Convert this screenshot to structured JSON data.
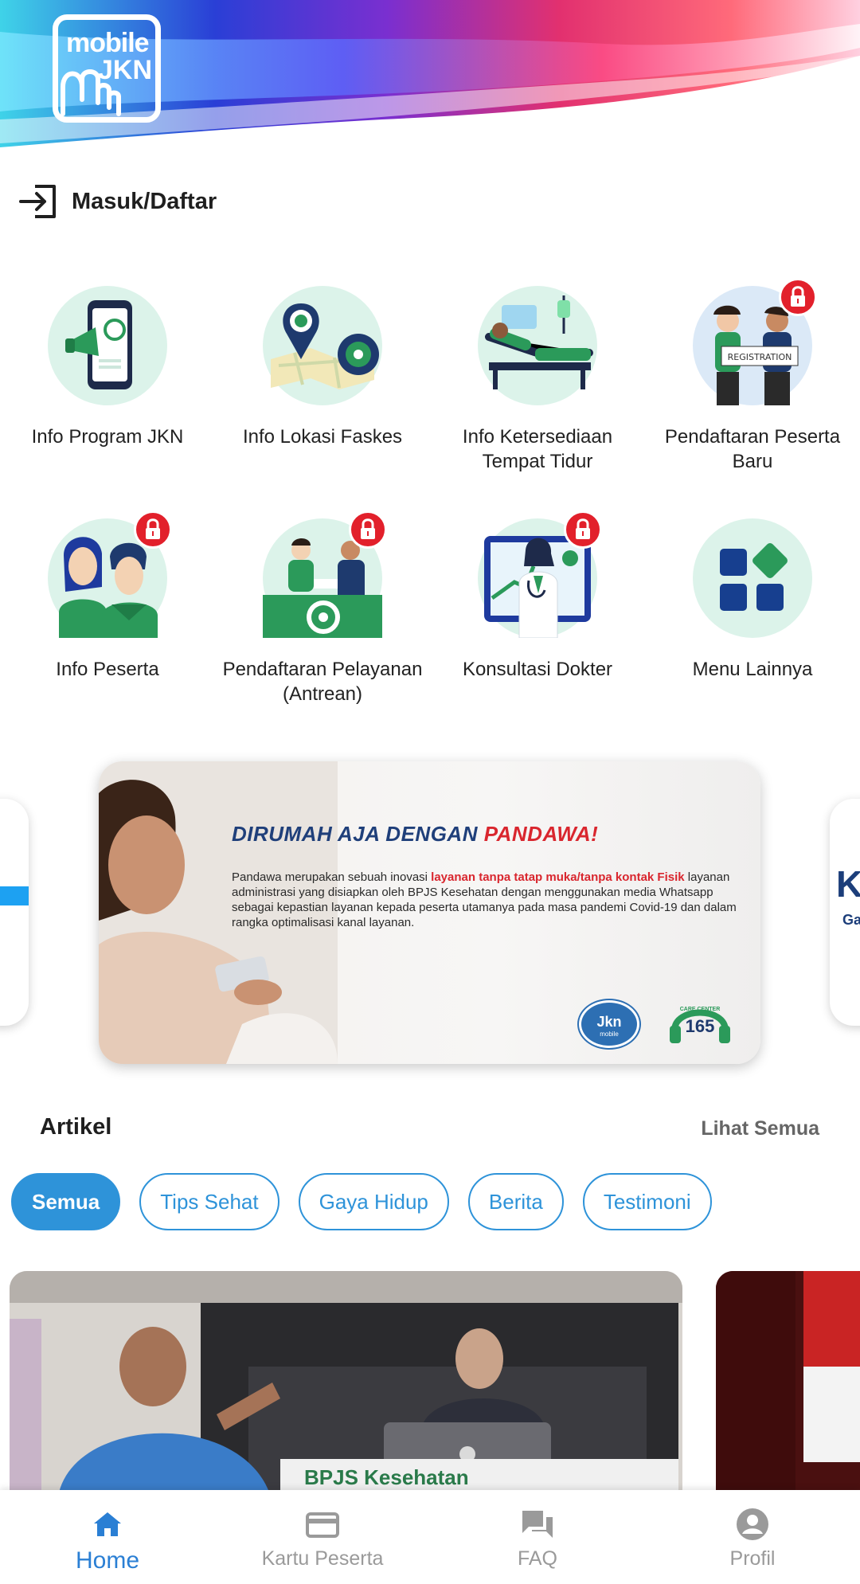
{
  "app": {
    "logo_line1": "mobile",
    "logo_line2": "JKN"
  },
  "login": {
    "label": "Masuk/Daftar"
  },
  "menu": [
    {
      "label": "Info Program JKN",
      "icon": "megaphone-phone-icon",
      "locked": false
    },
    {
      "label": "Info Lokasi Faskes",
      "icon": "map-location-icon",
      "locked": false
    },
    {
      "label": "Info Ketersediaan Tempat Tidur",
      "icon": "hospital-bed-icon",
      "locked": false
    },
    {
      "label": "Pendaftaran Peserta Baru",
      "icon": "registration-people-icon",
      "locked": true
    },
    {
      "label": "Info Peserta",
      "icon": "participants-icon",
      "locked": true
    },
    {
      "label": "Pendaftaran Pelayanan (Antrean)",
      "icon": "service-queue-icon",
      "locked": true
    },
    {
      "label": "Konsultasi Dokter",
      "icon": "doctor-consultation-icon",
      "locked": true
    },
    {
      "label": "Menu Lainnya",
      "icon": "grid-more-icon",
      "locked": false
    }
  ],
  "banner": {
    "title_part1": "DIRUMAH AJA DENGAN ",
    "title_part2": "PANDAWA!",
    "body_part1": "Pandawa merupakan sebuah inovasi ",
    "body_highlight": "layanan tanpa tatap muka/tanpa kontak Fisik",
    "body_part2": " layanan administrasi yang disiapkan oleh BPJS Kesehatan dengan menggunakan media Whatsapp sebagai kepastian layanan kepada peserta utamanya pada masa pandemi Covid-19 dan dalam rangka optimalisasi kanal layanan.",
    "badge_jkn": "Jkn",
    "badge_jkn_sub": "mobile",
    "badge_care": "165",
    "badge_care_label": "CARE CENTER",
    "peek_right_letter": "K",
    "peek_right_sub": "Ga"
  },
  "articles": {
    "title": "Artikel",
    "see_all": "Lihat Semua",
    "chips": [
      "Semua",
      "Tips Sehat",
      "Gaya Hidup",
      "Berita",
      "Testimoni"
    ],
    "active_chip": "Semua",
    "card1_sign": "BPJS Kesehatan"
  },
  "bottom_nav": [
    {
      "label": "Home",
      "icon": "home-icon",
      "active": true
    },
    {
      "label": "Kartu Peserta",
      "icon": "card-icon",
      "active": false
    },
    {
      "label": "FAQ",
      "icon": "chat-icon",
      "active": false
    },
    {
      "label": "Profil",
      "icon": "profile-icon",
      "active": false
    }
  ],
  "colors": {
    "accent": "#2e93d9",
    "nav_active": "#2a7fd4",
    "lock_red": "#e2202b",
    "menu_bg": "#dcf3ea",
    "brand_navy": "#1f3f7a"
  }
}
